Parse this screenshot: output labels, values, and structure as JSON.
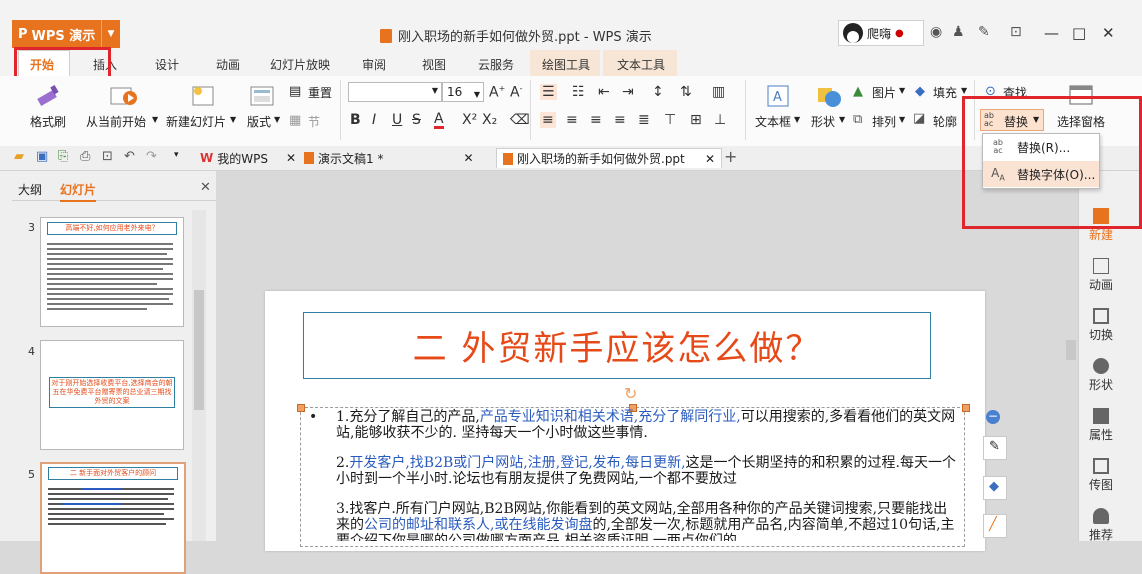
{
  "app": {
    "name": "WPS 演示",
    "logo_glyph": "P"
  },
  "window": {
    "title": "刚入职场的新手如何做外贸.ppt - WPS 演示",
    "user_name": "爬嗨"
  },
  "menu_tabs": [
    "开始",
    "插入",
    "设计",
    "动画",
    "幻灯片放映",
    "审阅",
    "视图",
    "云服务",
    "绘图工具",
    "文本工具"
  ],
  "ribbon": {
    "format_painter": "格式刷",
    "from_current": "从当前开始",
    "new_slide": "新建幻灯片",
    "layout": "版式",
    "reset": "重置",
    "section": "节",
    "font_name": "",
    "font_size": "16",
    "bold": "B",
    "italic": "I",
    "underline": "U",
    "strike": "S",
    "text_box": "文本框",
    "shape": "形状",
    "picture": "图片",
    "fill": "填充",
    "arrange": "排列",
    "outline": "轮廓",
    "find": "查找",
    "replace": "替换",
    "select_pane": "选择窗格"
  },
  "replace_menu": [
    {
      "label": "替换(R)...",
      "icon": "ab-ac-replace-icon"
    },
    {
      "label": "替换字体(O)...",
      "icon": "font-replace-icon"
    }
  ],
  "doc_tabs": [
    {
      "label": "我的WPS",
      "icon": "wps-logo-icon"
    },
    {
      "label": "演示文稿1 *",
      "icon": "ppt-file-icon"
    },
    {
      "label": "刚入职场的新手如何做外贸.ppt",
      "icon": "ppt-file-icon"
    }
  ],
  "left_panel": {
    "tabs": [
      "大纲",
      "幻灯片"
    ],
    "slides": [
      {
        "num": "3",
        "title": "高端不好,如何应用老外来电？"
      },
      {
        "num": "4",
        "text": "对于刚开始选择收费平台,选择商会的朝五在华免费平台赠寄票的总业请三期找外贸的文案"
      },
      {
        "num": "5",
        "title": "二 新手面对外贸客户的顾问"
      }
    ]
  },
  "slide": {
    "title": "二  外贸新手应该怎么做？",
    "paragraphs": [
      {
        "pre": "1.充分了解自己的产品,",
        "hl": "产品专业知识和相关术语,充分了解同行业,",
        "post": "可以用搜索的,多看看他们的英文网站,能够收获不少的. 坚持每天一个小时做这些事情."
      },
      {
        "pre": "2.",
        "hl": "开发客户,找B2B或门户网站,注册,登记,发布,每日更新,",
        "post": "这是一个长期坚持的和积累的过程.每天一个小时到一个半小时.论坛也有朋友提供了免费网站,一个都不要放过"
      },
      {
        "pre": "3.找客户.所有门户网站,B2B网站,你能看到的英文网站,全部用各种你的产品关键词搜索,只要能找出来的",
        "hl": "公司的邮址和联系人,或在线能发询盘",
        "post": "的,全部发一次,标题就用产品名,内容简单,不超过10句话,主要介绍下你是哪的公司做哪方面产品,相关资质证明,一两点你们的"
      }
    ]
  },
  "right_sidebar": [
    "新建",
    "动画",
    "切换",
    "形状",
    "属性",
    "传图",
    "推荐"
  ],
  "colors": {
    "accent": "#e8731f",
    "title_red": "#e64a19",
    "link_blue": "#2a5bbf",
    "highlight_box": "#e0262d"
  }
}
